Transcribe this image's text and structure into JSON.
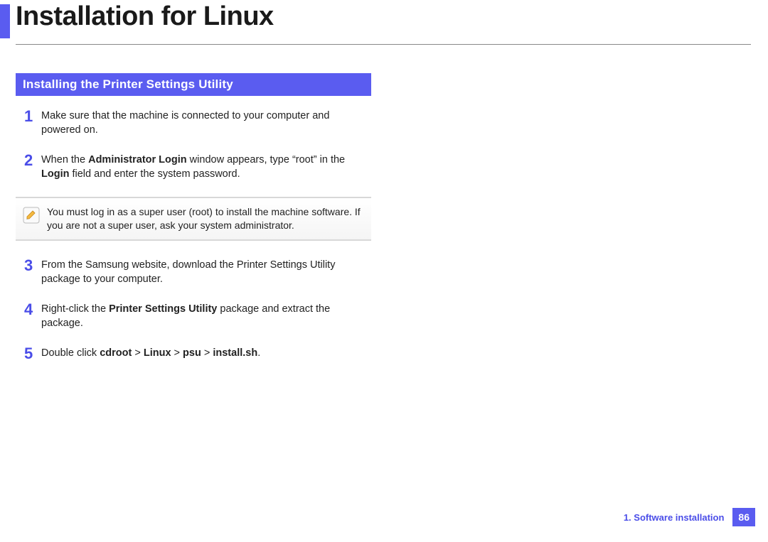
{
  "page_title": "Installation for Linux",
  "section_header": "Installing the Printer Settings Utility",
  "steps": [
    {
      "num": "1",
      "text": "Make sure that the machine is connected to your computer and powered on."
    },
    {
      "num": "2",
      "pre": "When the ",
      "b1": "Administrator Login",
      "mid": " window appears, type “root” in the ",
      "b2": "Login",
      "post": " field and enter the system password."
    }
  ],
  "note": "You must log in as a super user (root) to install the machine software. If you are not a super user, ask your system administrator.",
  "steps2": [
    {
      "num": "3",
      "text": "From the Samsung website, download the Printer Settings Utility package to your computer."
    },
    {
      "num": "4",
      "pre": "Right-click the ",
      "b1": "Printer Settings Utility",
      "post": " package and extract the package."
    },
    {
      "num": "5",
      "pre": "Double click ",
      "b1": "cdroot",
      "s1": " > ",
      "b2": "Linux",
      "s2": " > ",
      "b3": "psu",
      "s3": " > ",
      "b4": "install.sh",
      "post": "."
    }
  ],
  "footer": {
    "chapter": "1.  Software installation",
    "page": "86"
  }
}
